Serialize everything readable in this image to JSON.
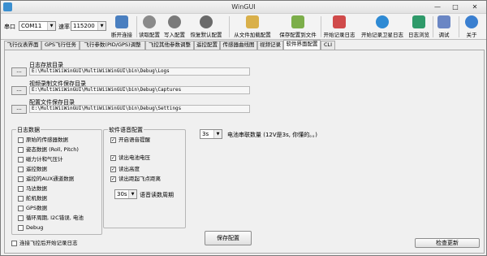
{
  "window": {
    "title": "WinGUI",
    "min": "—",
    "max": "□",
    "close": "✕"
  },
  "toolbar": {
    "port_label": "串口",
    "port_value": "COM11",
    "baud_label": "速率",
    "baud_value": "115200",
    "buttons": [
      {
        "label": "断开连接",
        "icon": "disconnect-icon",
        "color": "#4a7fc0"
      },
      {
        "label": "读取配置",
        "icon": "gear-icon",
        "color": "#8a8a8a"
      },
      {
        "label": "写入配置",
        "icon": "gear-icon",
        "color": "#7a7a7a"
      },
      {
        "label": "恢复默认配置",
        "icon": "gear-icon",
        "color": "#6a6a6a"
      },
      {
        "label": "从文件加载配置",
        "icon": "folder-open-icon",
        "color": "#d9b04a"
      },
      {
        "label": "保存配置到文件",
        "icon": "save-file-icon",
        "color": "#7cae4a"
      },
      {
        "label": "开始记录日志",
        "icon": "record-log-icon",
        "color": "#d04a4a"
      },
      {
        "label": "开始记录卫星日志",
        "icon": "globe-icon",
        "color": "#2e8ad4"
      },
      {
        "label": "日志浏览",
        "icon": "log-browser-icon",
        "color": "#2f9a6a"
      },
      {
        "label": "调试",
        "icon": "debug-icon",
        "color": "#6a86c4"
      },
      {
        "label": "关于",
        "icon": "info-icon",
        "color": "#3a7fd0"
      }
    ]
  },
  "tabs": [
    {
      "label": "飞行仪表界面",
      "active": false
    },
    {
      "label": "GPS飞行任务",
      "active": false
    },
    {
      "label": "飞行参数(PID/GPS)调整",
      "active": false
    },
    {
      "label": "飞控其他参数调整",
      "active": false
    },
    {
      "label": "遥控配置",
      "active": false
    },
    {
      "label": "传感器曲线图",
      "active": false
    },
    {
      "label": "视频记录",
      "active": false
    },
    {
      "label": "软件界面配置",
      "active": true
    },
    {
      "label": "CLI",
      "active": false
    }
  ],
  "paths": [
    {
      "label": "日志存放目录",
      "browse": "...",
      "value": "E:\\MultiWiiWinGUI\\MultiWiiWinGUI\\bin\\Debug\\Logs"
    },
    {
      "label": "视频录制文件保存目录",
      "browse": "...",
      "value": "E:\\MultiWiiWinGUI\\MultiWiiWinGUI\\bin\\Debug\\Captures"
    },
    {
      "label": "配置文件保存目录",
      "browse": "...",
      "value": "E:\\MultiWiiWinGUI\\MultiWiiWinGUI\\bin\\Debug\\Settings"
    }
  ],
  "log_group": {
    "title": "日志数据",
    "items": [
      {
        "label": "原始的传感器数据",
        "checked": false
      },
      {
        "label": "姿态数据 (Roll, Pitch)",
        "checked": false
      },
      {
        "label": "磁力计和气压计",
        "checked": false
      },
      {
        "label": "遥控数据",
        "checked": false
      },
      {
        "label": "遥控的AUX通道数据",
        "checked": false
      },
      {
        "label": "马达数据",
        "checked": false
      },
      {
        "label": "舵机数据",
        "checked": false
      },
      {
        "label": "GPS数据",
        "checked": false
      },
      {
        "label": "循环周期, I2C错误, 电池",
        "checked": false
      },
      {
        "label": "Debug",
        "checked": false
      }
    ]
  },
  "voice_group": {
    "title": "软件语音配置",
    "items": [
      {
        "label": "开启语音提醒",
        "checked": true
      },
      {
        "label": "读出电池电压",
        "checked": true
      },
      {
        "label": "读出高度",
        "checked": true
      },
      {
        "label": "读出距起飞点距离",
        "checked": true
      }
    ],
    "interval_value": "30s",
    "interval_label": "语音读数周期"
  },
  "battery": {
    "value": "3s",
    "label": "电池串联数量 (12V是3s, 你懂的。。)"
  },
  "footer": {
    "autolog_label": "连接飞控后开始记录日志",
    "autolog_checked": false,
    "save_button": "保存配置",
    "update_button": "检查更新"
  }
}
